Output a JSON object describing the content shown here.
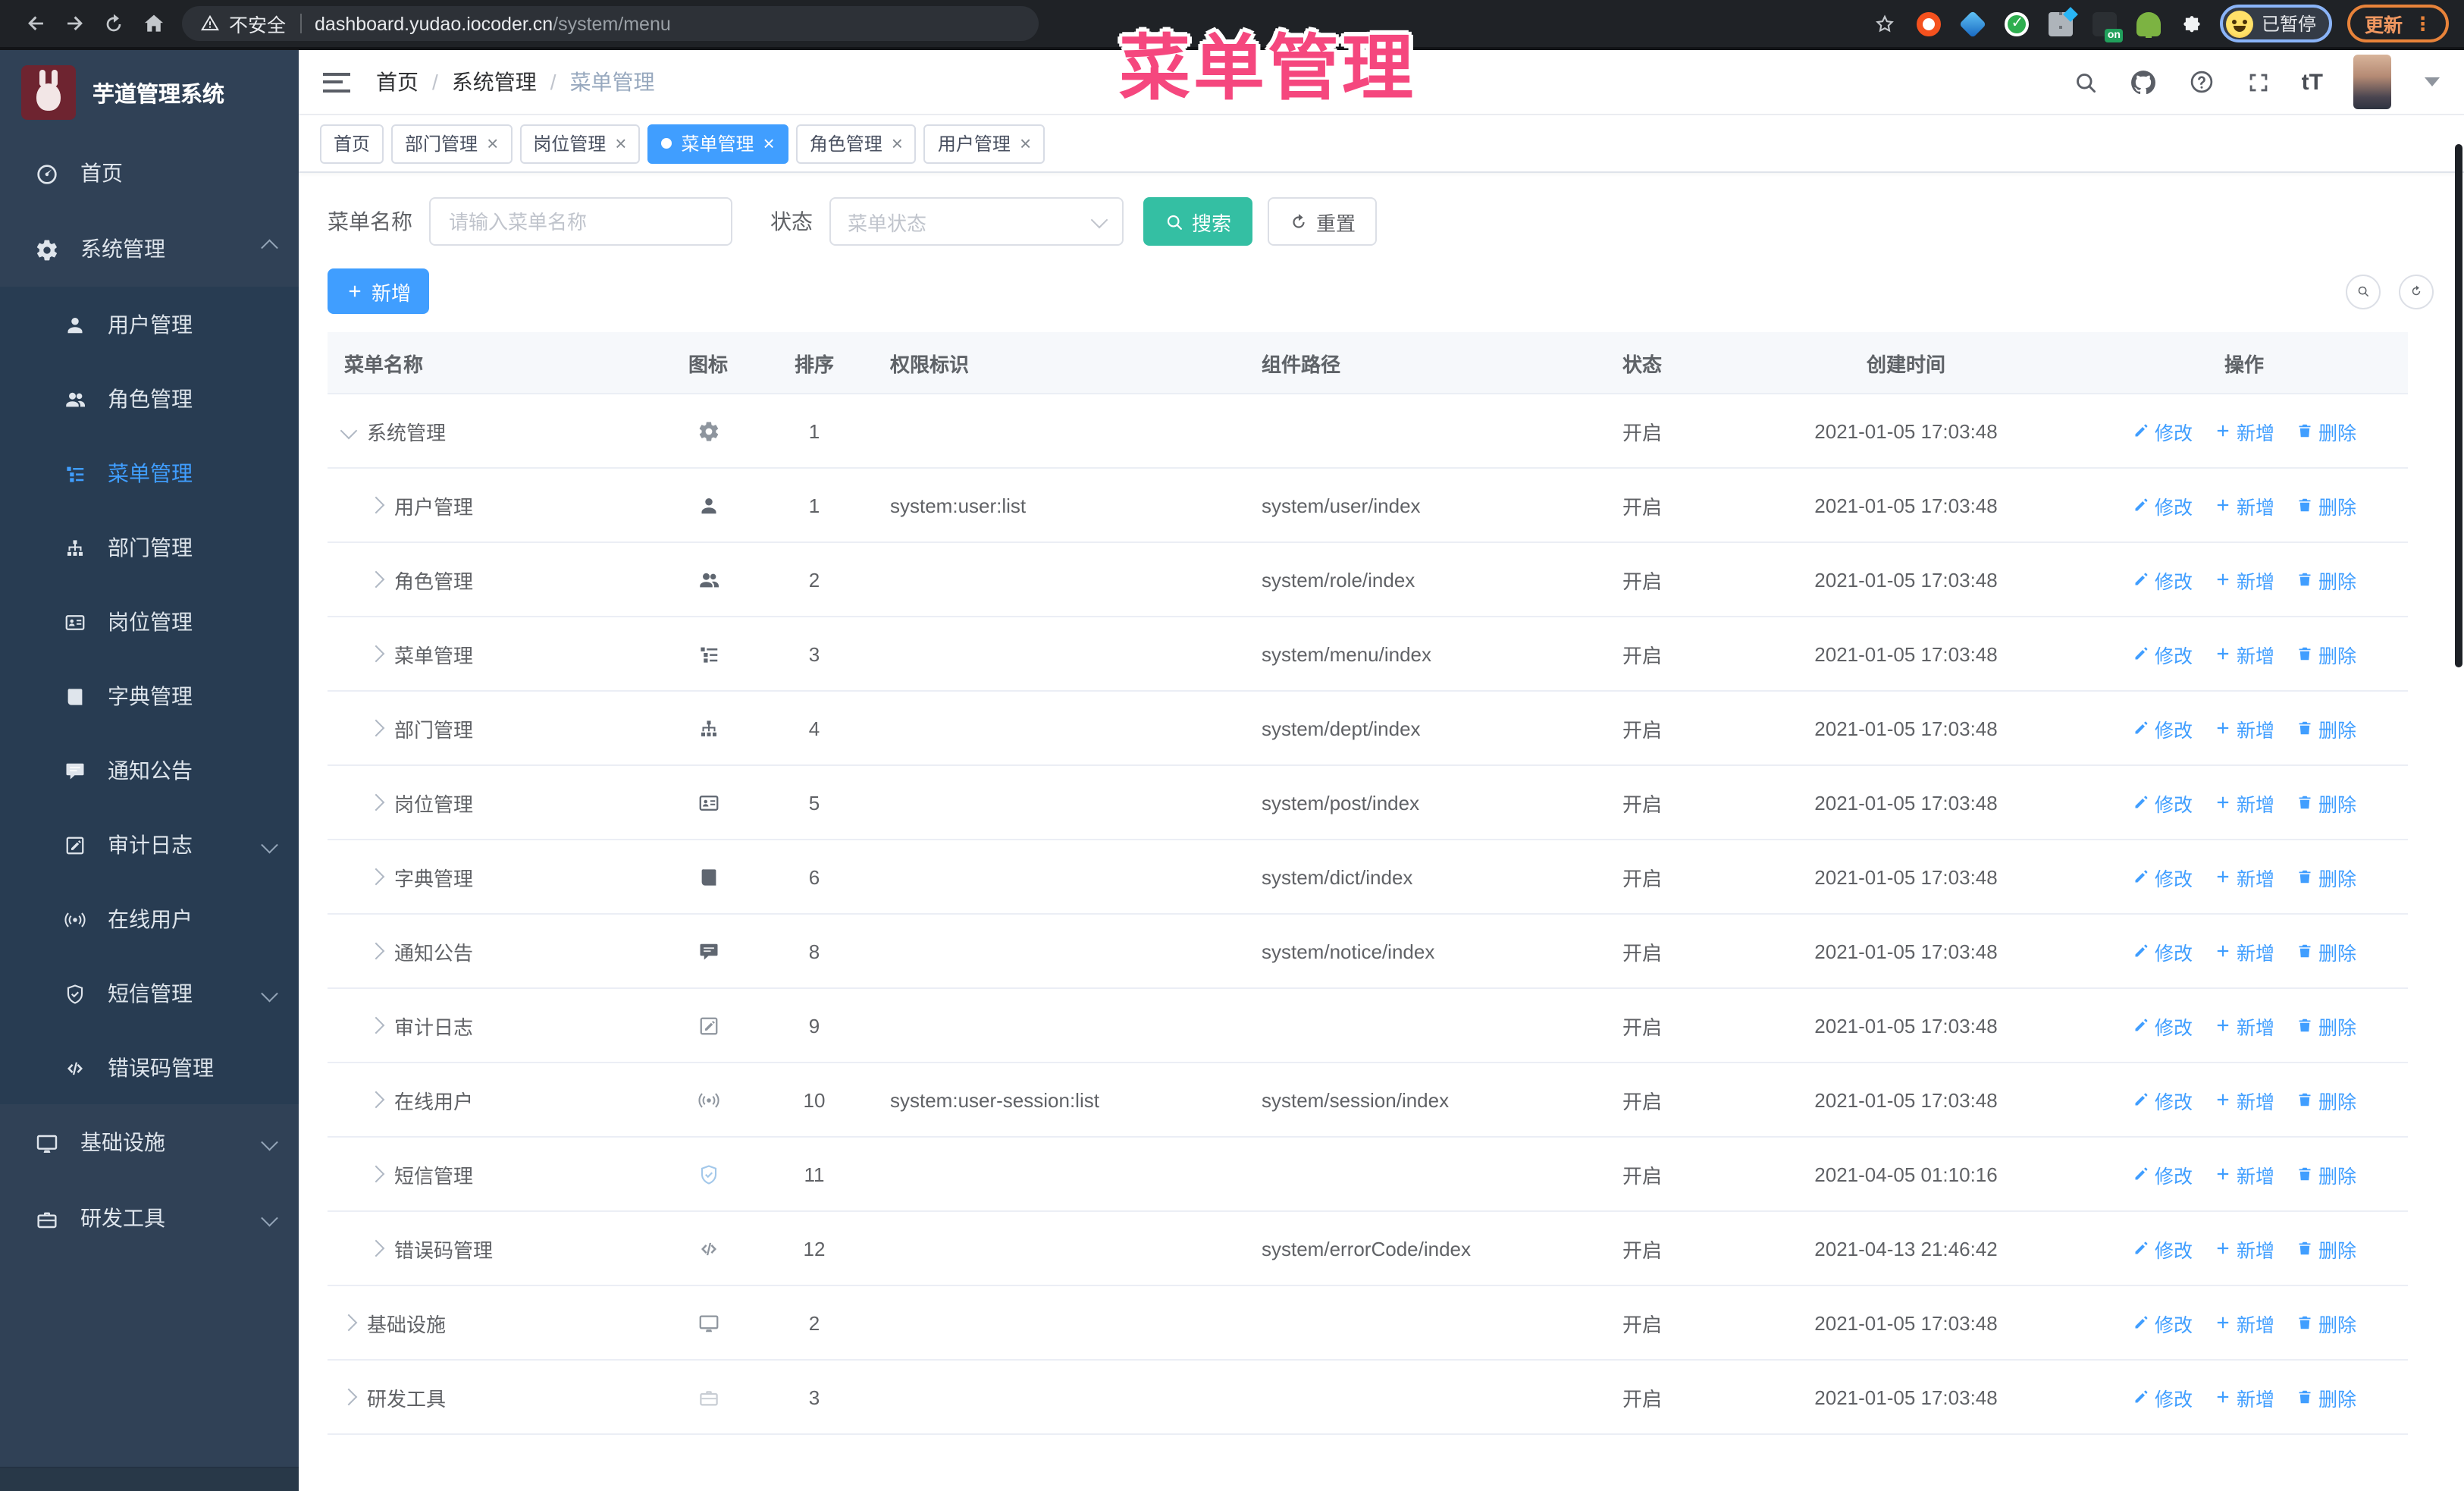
{
  "colors": {
    "accent": "#409eff",
    "search_teal": "#34bfa3",
    "annotation_pink": "#f5477e",
    "sidebar_bg": "#304156"
  },
  "browser": {
    "secure_warning": "不安全",
    "url_host": "dashboard.yudao.iocoder.cn",
    "url_path": "/system/menu",
    "extension_badge": "on",
    "profile_status": "已暂停",
    "update_label": "更新",
    "menu_dots": "⋮"
  },
  "annotation": {
    "text": "菜单管理"
  },
  "app_title": "芋道管理系统",
  "sidebar": {
    "items": [
      {
        "label": "首页",
        "icon": "dashboard"
      },
      {
        "label": "系统管理",
        "icon": "gear",
        "expanded": true,
        "children": [
          {
            "label": "用户管理",
            "icon": "user"
          },
          {
            "label": "角色管理",
            "icon": "users"
          },
          {
            "label": "菜单管理",
            "icon": "menu",
            "active": true
          },
          {
            "label": "部门管理",
            "icon": "tree"
          },
          {
            "label": "岗位管理",
            "icon": "post"
          },
          {
            "label": "字典管理",
            "icon": "dict"
          },
          {
            "label": "通知公告",
            "icon": "message"
          },
          {
            "label": "审计日志",
            "icon": "log",
            "chevron": "down"
          },
          {
            "label": "在线用户",
            "icon": "online"
          },
          {
            "label": "短信管理",
            "icon": "sms",
            "chevron": "down"
          },
          {
            "label": "错误码管理",
            "icon": "code"
          }
        ]
      },
      {
        "label": "基础设施",
        "icon": "monitor",
        "chevron": "down"
      },
      {
        "label": "研发工具",
        "icon": "tool",
        "chevron": "down"
      }
    ]
  },
  "breadcrumb": {
    "separator": "/",
    "items": [
      "首页",
      "系统管理",
      "菜单管理"
    ]
  },
  "tabs": [
    {
      "label": "首页",
      "closable": false,
      "active": false
    },
    {
      "label": "部门管理",
      "closable": true,
      "active": false
    },
    {
      "label": "岗位管理",
      "closable": true,
      "active": false
    },
    {
      "label": "菜单管理",
      "closable": true,
      "active": true
    },
    {
      "label": "角色管理",
      "closable": true,
      "active": false
    },
    {
      "label": "用户管理",
      "closable": true,
      "active": false
    }
  ],
  "filters": {
    "name_label": "菜单名称",
    "name_placeholder": "请输入菜单名称",
    "status_label": "状态",
    "status_placeholder": "菜单状态",
    "search_label": "搜索",
    "reset_label": "重置"
  },
  "toolbar": {
    "add_label": "新增"
  },
  "table": {
    "columns": [
      "菜单名称",
      "图标",
      "排序",
      "权限标识",
      "组件路径",
      "状态",
      "创建时间",
      "操作"
    ],
    "actions": {
      "edit": "修改",
      "add": "新增",
      "delete": "删除"
    },
    "rows": [
      {
        "name": "系统管理",
        "icon": "gear",
        "icon_class": "ic-gray",
        "level": 0,
        "caret": "down",
        "sort": "1",
        "perm": "",
        "path": "",
        "status": "开启",
        "created": "2021-01-05 17:03:48"
      },
      {
        "name": "用户管理",
        "icon": "user",
        "icon_class": "",
        "level": 1,
        "caret": "right",
        "sort": "1",
        "perm": "system:user:list",
        "path": "system/user/index",
        "status": "开启",
        "created": "2021-01-05 17:03:48"
      },
      {
        "name": "角色管理",
        "icon": "users",
        "icon_class": "",
        "level": 1,
        "caret": "right",
        "sort": "2",
        "perm": "",
        "path": "system/role/index",
        "status": "开启",
        "created": "2021-01-05 17:03:48"
      },
      {
        "name": "菜单管理",
        "icon": "menu",
        "icon_class": "",
        "level": 1,
        "caret": "right",
        "sort": "3",
        "perm": "",
        "path": "system/menu/index",
        "status": "开启",
        "created": "2021-01-05 17:03:48"
      },
      {
        "name": "部门管理",
        "icon": "tree",
        "icon_class": "",
        "level": 1,
        "caret": "right",
        "sort": "4",
        "perm": "",
        "path": "system/dept/index",
        "status": "开启",
        "created": "2021-01-05 17:03:48"
      },
      {
        "name": "岗位管理",
        "icon": "post",
        "icon_class": "",
        "level": 1,
        "caret": "right",
        "sort": "5",
        "perm": "",
        "path": "system/post/index",
        "status": "开启",
        "created": "2021-01-05 17:03:48"
      },
      {
        "name": "字典管理",
        "icon": "dict",
        "icon_class": "",
        "level": 1,
        "caret": "right",
        "sort": "6",
        "perm": "",
        "path": "system/dict/index",
        "status": "开启",
        "created": "2021-01-05 17:03:48"
      },
      {
        "name": "通知公告",
        "icon": "message",
        "icon_class": "",
        "level": 1,
        "caret": "right",
        "sort": "8",
        "perm": "",
        "path": "system/notice/index",
        "status": "开启",
        "created": "2021-01-05 17:03:48"
      },
      {
        "name": "审计日志",
        "icon": "log",
        "icon_class": "ic-gray",
        "level": 1,
        "caret": "right",
        "sort": "9",
        "perm": "",
        "path": "",
        "status": "开启",
        "created": "2021-01-05 17:03:48"
      },
      {
        "name": "在线用户",
        "icon": "online",
        "icon_class": "ic-gray",
        "level": 1,
        "caret": "right",
        "sort": "10",
        "perm": "system:user-session:list",
        "path": "system/session/index",
        "status": "开启",
        "created": "2021-01-05 17:03:48"
      },
      {
        "name": "短信管理",
        "icon": "sms",
        "icon_class": "ic-blue",
        "level": 1,
        "caret": "right",
        "sort": "11",
        "perm": "",
        "path": "",
        "status": "开启",
        "created": "2021-04-05 01:10:16"
      },
      {
        "name": "错误码管理",
        "icon": "code",
        "icon_class": "ic-gray",
        "level": 1,
        "caret": "right",
        "sort": "12",
        "perm": "",
        "path": "system/errorCode/index",
        "status": "开启",
        "created": "2021-04-13 21:46:42"
      },
      {
        "name": "基础设施",
        "icon": "monitor",
        "icon_class": "ic-gray",
        "level": 0,
        "caret": "right",
        "sort": "2",
        "perm": "",
        "path": "",
        "status": "开启",
        "created": "2021-01-05 17:03:48"
      },
      {
        "name": "研发工具",
        "icon": "tool",
        "icon_class": "ic-light",
        "level": 0,
        "caret": "right",
        "sort": "3",
        "perm": "",
        "path": "",
        "status": "开启",
        "created": "2021-01-05 17:03:48"
      }
    ]
  },
  "glyphs": {
    "close": "×",
    "check": "✓"
  }
}
